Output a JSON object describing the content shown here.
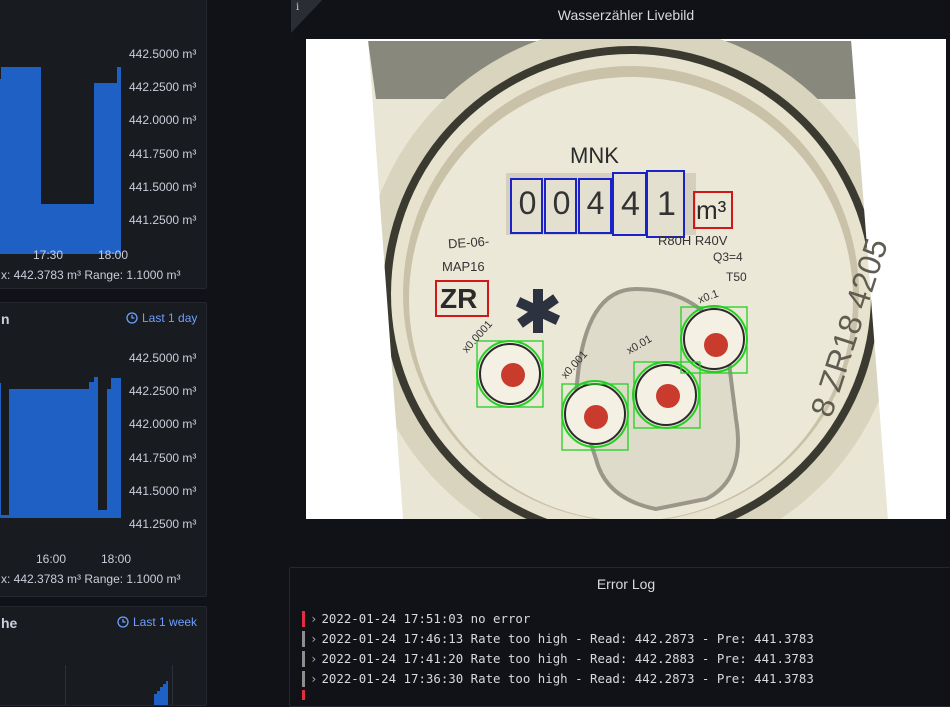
{
  "colors": {
    "bar": "#1f60c4",
    "accent": "#6e9fff",
    "log_error": "#e02f44",
    "log_ok": "#8e8e8e"
  },
  "chart_top": {
    "y_ticks": [
      "442.5000 m³",
      "442.2500 m³",
      "442.0000 m³",
      "441.7500 m³",
      "441.5000 m³",
      "441.2500 m³"
    ],
    "x_ticks": [
      "17:30",
      "18:00"
    ],
    "stats": "x: 442.3783 m³   Range: 1.1000 m³"
  },
  "chart_mid": {
    "title": "n",
    "time_badge": "Last 1 day",
    "y_ticks": [
      "442.5000 m³",
      "442.2500 m³",
      "442.0000 m³",
      "441.7500 m³",
      "441.5000 m³",
      "441.2500 m³"
    ],
    "x_ticks": [
      "16:00",
      "18:00"
    ],
    "stats": "x: 442.3783 m³   Range: 1.1000 m³"
  },
  "chart_bottom": {
    "title": "he",
    "time_badge": "Last 1 week"
  },
  "livebild": {
    "info_icon": "i",
    "title": "Wasserzähler Livebild",
    "meter_brand": "MNK",
    "digits": [
      "0",
      "0",
      "4",
      "4",
      "1"
    ],
    "unit": "m³",
    "serial": "DE-06-",
    "spec1": "R80H R40V",
    "spec2": "Q3=4",
    "spec3": "T50",
    "model": "MAP16",
    "zr_label": "ZR",
    "dial_labels": [
      "x0.0001",
      "x0.001",
      "x0.01",
      "x0.1"
    ]
  },
  "error_log": {
    "title": "Error Log",
    "lines": [
      {
        "text": "2022-01-24 17:51:03 no error",
        "color": "#e02f44"
      },
      {
        "text": "2022-01-24 17:46:13 Rate too high - Read: 442.2873 - Pre: 441.3783",
        "color": "#8e8e8e"
      },
      {
        "text": "2022-01-24 17:41:20 Rate too high - Read: 442.2883 - Pre: 441.3783",
        "color": "#8e8e8e"
      },
      {
        "text": "2022-01-24 17:36:30 Rate too high - Read: 442.2873 - Pre: 441.3783",
        "color": "#8e8e8e"
      }
    ]
  }
}
